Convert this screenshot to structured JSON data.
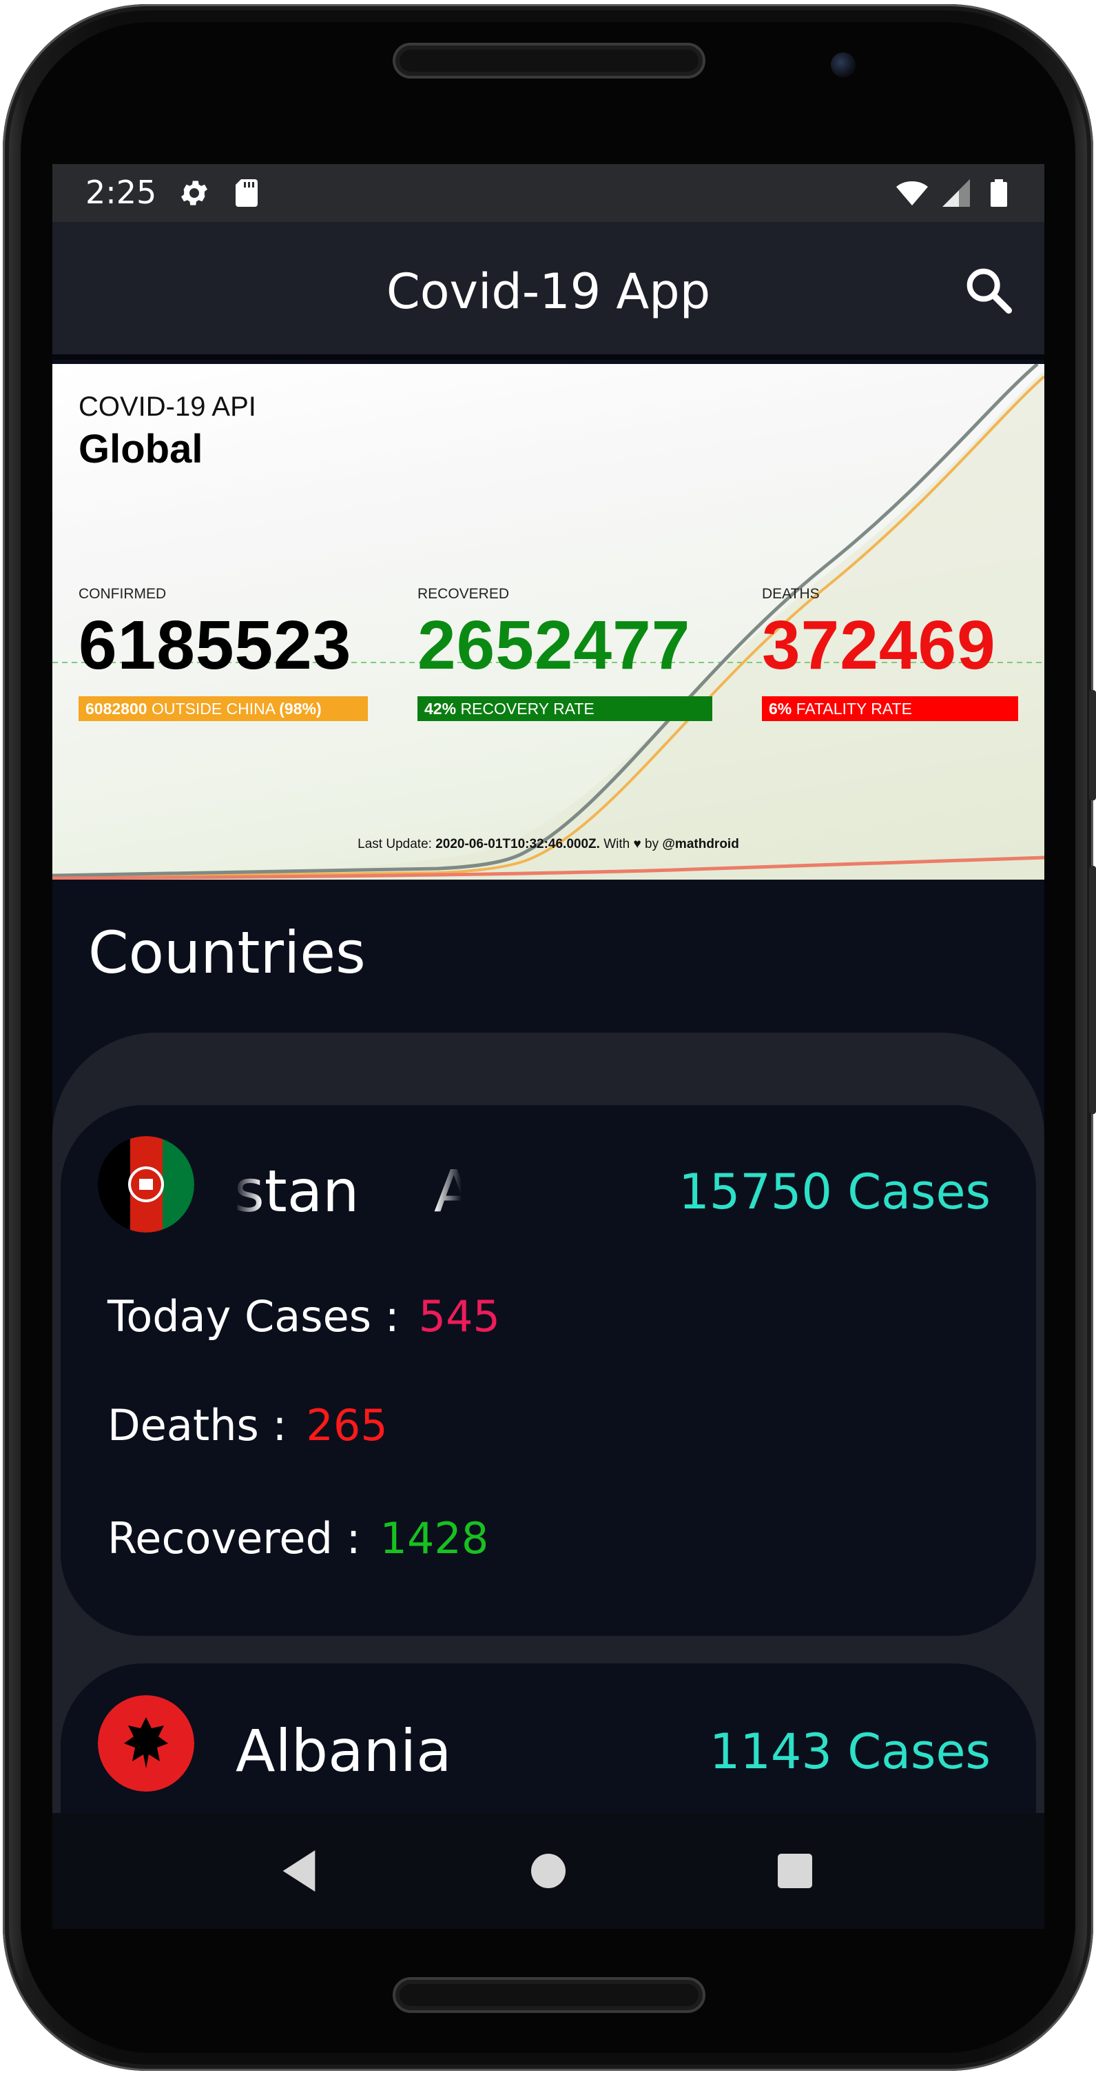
{
  "status_bar": {
    "time": "2:25",
    "icons": [
      "gear-icon",
      "sd-card-icon",
      "wifi-icon",
      "signal-icon",
      "battery-icon"
    ]
  },
  "app_bar": {
    "title": "Covid-19 App",
    "search_icon": "search-icon"
  },
  "banner": {
    "api_label": "COVID-19 API",
    "scope": "Global",
    "confirmed": {
      "label": "CONFIRMED",
      "value": "6185523",
      "sub_value": "6082800",
      "sub_text": "OUTSIDE CHINA",
      "sub_pct": "(98%)",
      "color": "#000000",
      "bar_color": "#f5a623"
    },
    "recovered": {
      "label": "RECOVERED",
      "value": "2652477",
      "sub_value": "42%",
      "sub_text": "RECOVERY RATE",
      "color": "#0a8a12",
      "bar_color": "#0a7d10"
    },
    "deaths": {
      "label": "DEATHS",
      "value": "372469",
      "sub_value": "6%",
      "sub_text": "FATALITY RATE",
      "color": "#ee1111",
      "bar_color": "#ff0000"
    },
    "update_prefix": "Last Update:",
    "update_time": "2020-06-01T10:32:46.000Z.",
    "update_with": "With",
    "update_by": "by",
    "update_author": "@mathdroid"
  },
  "countries": {
    "title": "Countries",
    "items": [
      {
        "name_visible": "stan",
        "name_trailing": "A",
        "cases": "15750 Cases",
        "flag_icon": "afghanistan-flag-icon",
        "today_label": "Today Cases :",
        "today_value": "545",
        "deaths_label": "Deaths :",
        "deaths_value": "265",
        "recovered_label": "Recovered :",
        "recovered_value": "1428"
      },
      {
        "name_visible": "Albania",
        "cases": "1143 Cases",
        "flag_icon": "albania-flag-icon"
      }
    ]
  },
  "colors": {
    "accent_cases": "#2de0c8",
    "today": "#ee1c5a",
    "deaths": "#ff1a1a",
    "recovered": "#18c021"
  },
  "nav_bar": {
    "icons": [
      "back-icon",
      "home-icon",
      "recents-icon"
    ]
  }
}
